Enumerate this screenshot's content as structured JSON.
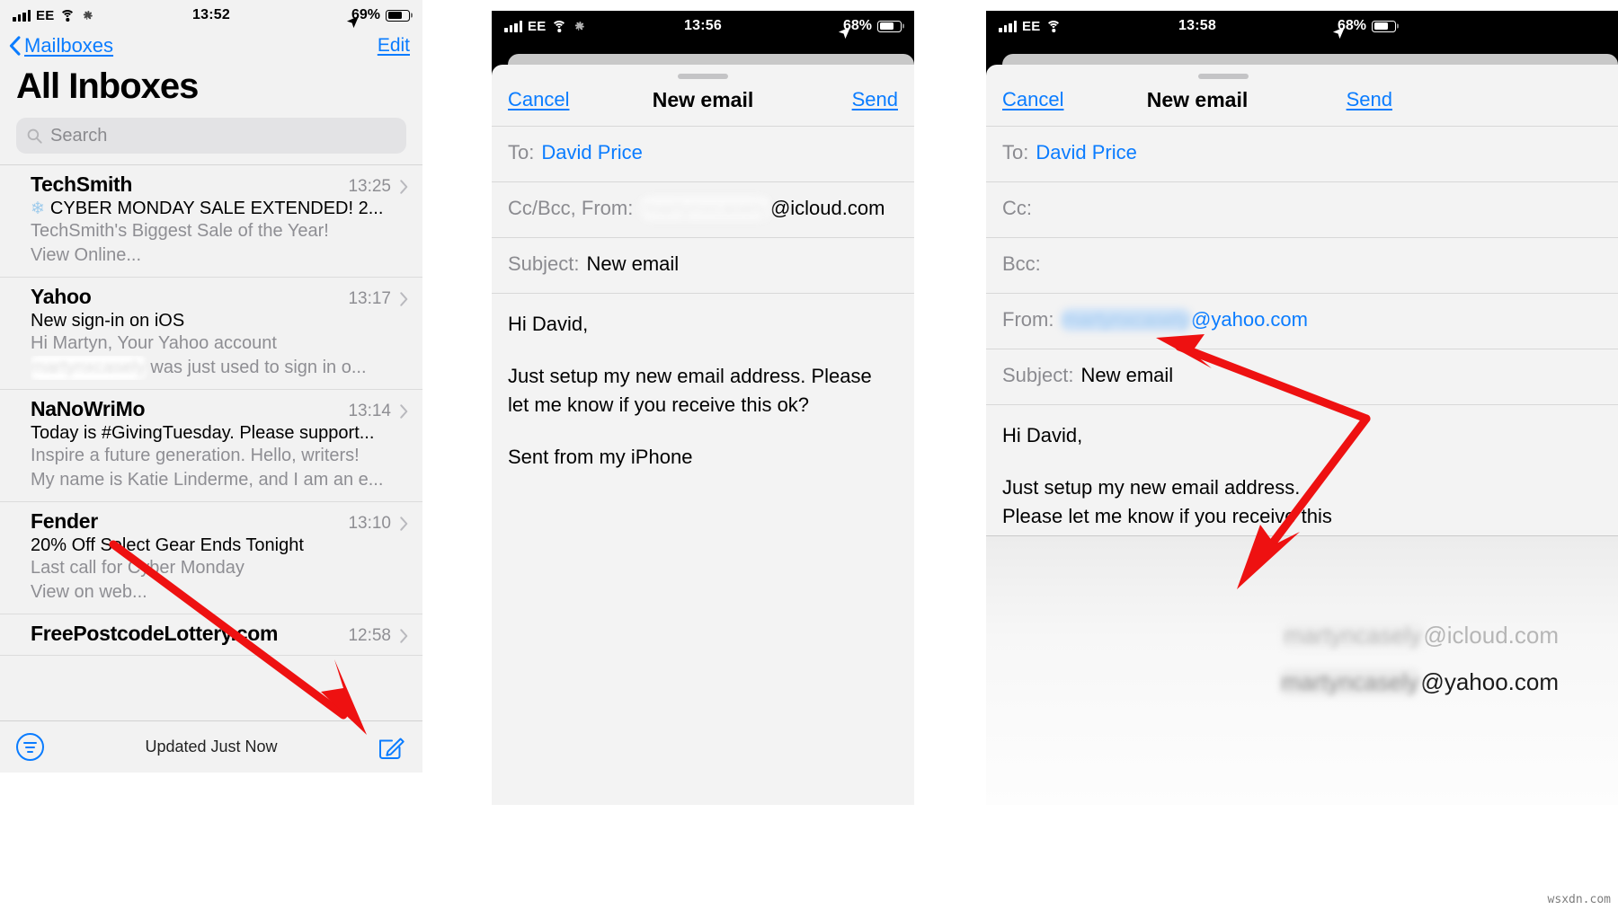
{
  "panel1": {
    "status": {
      "carrier": "EE",
      "time": "13:52",
      "battery": "69%"
    },
    "nav": {
      "back": "Mailboxes",
      "edit": "Edit"
    },
    "title": "All Inboxes",
    "search_placeholder": "Search",
    "messages": [
      {
        "sender": "TechSmith",
        "time": "13:25",
        "subject_emoji": "❄",
        "subject": "CYBER MONDAY SALE EXTENDED! 2...",
        "snippet1": "TechSmith's Biggest Sale of the Year!",
        "snippet2": "View Online..."
      },
      {
        "sender": "Yahoo",
        "time": "13:17",
        "subject": "New sign-in on iOS",
        "snippet1": "Hi Martyn, Your Yahoo account",
        "snippet_redacted": "martynxcasely",
        "snippet2": "was just used to sign in o..."
      },
      {
        "sender": "NaNoWriMo",
        "time": "13:14",
        "subject": "Today is #GivingTuesday. Please support...",
        "snippet1": "Inspire a future generation. Hello, writers!",
        "snippet2": "My name is Katie Linderme, and I am an e..."
      },
      {
        "sender": "Fender",
        "time": "13:10",
        "subject": "20% Off Select Gear Ends Tonight",
        "snippet1": "Last call for Cyber Monday",
        "snippet2": "View on web..."
      },
      {
        "sender": "FreePostcodeLottery.com",
        "time": "12:58",
        "subject": "",
        "snippet1": "",
        "snippet2": ""
      }
    ],
    "toolbar": {
      "status_text": "Updated Just Now"
    }
  },
  "panel2": {
    "status": {
      "carrier": "EE",
      "time": "13:56",
      "battery": "68%"
    },
    "nav": {
      "cancel": "Cancel",
      "title": "New email",
      "send": "Send"
    },
    "fields": {
      "to_label": "To:",
      "to_value": "David Price",
      "ccbcc_from_label": "Cc/Bcc, From:",
      "from_redacted": "martynxcasely",
      "from_domain": "@icloud.com",
      "subject_label": "Subject:",
      "subject_value": "New email"
    },
    "body": {
      "greeting": "Hi David,",
      "paragraph": "Just setup my new email address. Please let me know if you receive this ok?",
      "signature": "Sent from my iPhone"
    }
  },
  "panel3": {
    "status": {
      "carrier": "EE",
      "time": "13:58",
      "battery": "68%"
    },
    "nav": {
      "cancel": "Cancel",
      "title": "New email",
      "send": "Send"
    },
    "fields": {
      "to_label": "To:",
      "to_value": "David Price",
      "cc_label": "Cc:",
      "cc_value": "",
      "bcc_label": "Bcc:",
      "bcc_value": "",
      "from_label": "From:",
      "from_redacted": "martynxcasely",
      "from_domain": "@yahoo.com",
      "subject_label": "Subject:",
      "subject_value": "New email"
    },
    "body": {
      "greeting": "Hi David,",
      "paragraph_line1": "Just setup my new email address.",
      "paragraph_line2": "Please let me know if you receive this"
    },
    "picker": {
      "option1_redacted": "martyncasely",
      "option1_domain": "@icloud.com",
      "option2_redacted": "martyncasely",
      "option2_domain": "@yahoo.com"
    }
  },
  "watermark": "wsxdn.com"
}
